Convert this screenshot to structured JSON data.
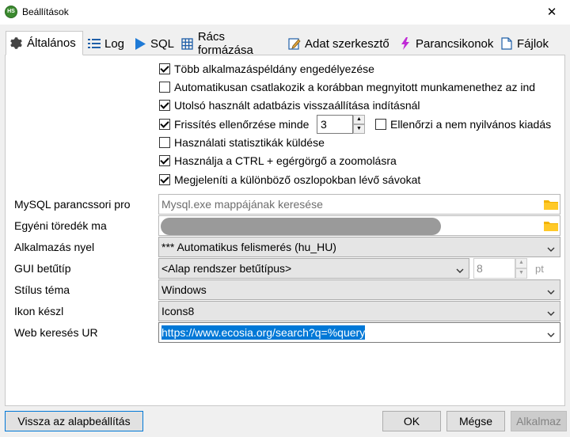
{
  "window": {
    "title": "Beállítások",
    "close_glyph": "✕",
    "logo_text": "HS"
  },
  "tabs": [
    {
      "label": "Általános",
      "icon": "gear-icon",
      "active": true
    },
    {
      "label": "Log",
      "icon": "list-icon"
    },
    {
      "label": "SQL",
      "icon": "play-icon"
    },
    {
      "label": "Rács formázása",
      "icon": "grid-icon"
    },
    {
      "label": "Adat szerkesztő",
      "icon": "edit-icon"
    },
    {
      "label": "Parancsikonok",
      "icon": "lightning-icon"
    },
    {
      "label": "Fájlok",
      "icon": "folder-icon"
    }
  ],
  "checkboxes": [
    {
      "label": "Több alkalmazáspéldány engedélyezése",
      "checked": true
    },
    {
      "label": "Automatikusan csatlakozik a korábban megnyitott munkamenethez az ind",
      "checked": false
    },
    {
      "label": "Utolsó használt adatbázis visszaállítása indításnál",
      "checked": true
    },
    {
      "label": "Frissítés ellenőrzése minde",
      "checked": true
    },
    {
      "label": "Ellenőrzi a nem nyilvános kiadás",
      "checked": false
    },
    {
      "label": "Használati statisztikák küldése",
      "checked": false
    },
    {
      "label": "Használja a CTRL + egérgörgő a zoomolásra",
      "checked": true
    },
    {
      "label": "Megjeleníti a különböző oszlopokban lévő sávokat",
      "checked": true
    }
  ],
  "update_interval": "3",
  "fields": {
    "mysql_label": "MySQL parancssori pro",
    "mysql_placeholder": "Mysql.exe mappájának keresése",
    "custom_snippets_label": "Egyéni töredék ma",
    "language_label": "Alkalmazás nyel",
    "language_value": "*** Automatikus felismerés (hu_HU)",
    "gui_font_label": "GUI betűtíp",
    "gui_font_value": "<Alap rendszer betűtípus>",
    "gui_font_size": "8",
    "gui_font_unit": "pt",
    "style_label": "Stílus téma",
    "style_value": "Windows",
    "icon_label": "Ikon készl",
    "icon_value": "Icons8",
    "web_search_label": "Web keresés UR",
    "web_search_value": "https://www.ecosia.org/search?q=%query"
  },
  "buttons": {
    "reset": "Vissza az alapbeállítás",
    "ok": "OK",
    "cancel": "Mégse",
    "apply": "Alkalmaz"
  },
  "colors": {
    "selection": "#0078d7",
    "logo": "#3b8a2f",
    "accent_border": "#0078d7"
  }
}
